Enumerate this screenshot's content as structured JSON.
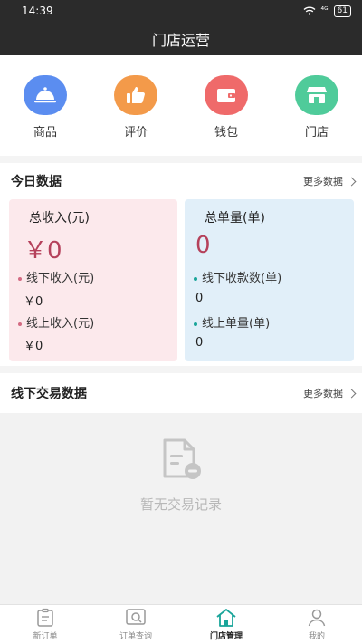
{
  "status": {
    "time": "14:39",
    "signal": "⁴ᴳ",
    "battery": "61"
  },
  "header": {
    "title": "门店运营"
  },
  "quick_actions": [
    {
      "label": "商品",
      "icon": "cloche-icon",
      "color": "#5b8df0"
    },
    {
      "label": "评价",
      "icon": "thumbs-up-icon",
      "color": "#f39a4a"
    },
    {
      "label": "钱包",
      "icon": "wallet-icon",
      "color": "#ef6a6a"
    },
    {
      "label": "门店",
      "icon": "storefront-icon",
      "color": "#4fcb9a"
    }
  ],
  "today": {
    "title": "今日数据",
    "more": "更多数据",
    "income": {
      "title": "总收入(元)",
      "value": "￥0",
      "offline_label": "线下收入(元)",
      "offline_value": "￥0",
      "online_label": "线上收入(元)",
      "online_value": "￥0"
    },
    "orders": {
      "title": "总单量(单)",
      "value": "0",
      "offline_label": "线下收款数(单)",
      "offline_value": "0",
      "online_label": "线上单量(单)",
      "online_value": "0"
    }
  },
  "offline": {
    "title": "线下交易数据",
    "more": "更多数据",
    "empty": "暂无交易记录"
  },
  "tabs": [
    {
      "label": "新订单",
      "icon": "clipboard-icon"
    },
    {
      "label": "订单查询",
      "icon": "order-search-icon"
    },
    {
      "label": "门店管理",
      "icon": "home-icon"
    },
    {
      "label": "我的",
      "icon": "profile-icon"
    }
  ],
  "colors": {
    "accent": "#1aa59a",
    "dark_bar": "#2b2b2b",
    "income_bg": "#fce9ec",
    "orders_bg": "#e1eff9"
  }
}
